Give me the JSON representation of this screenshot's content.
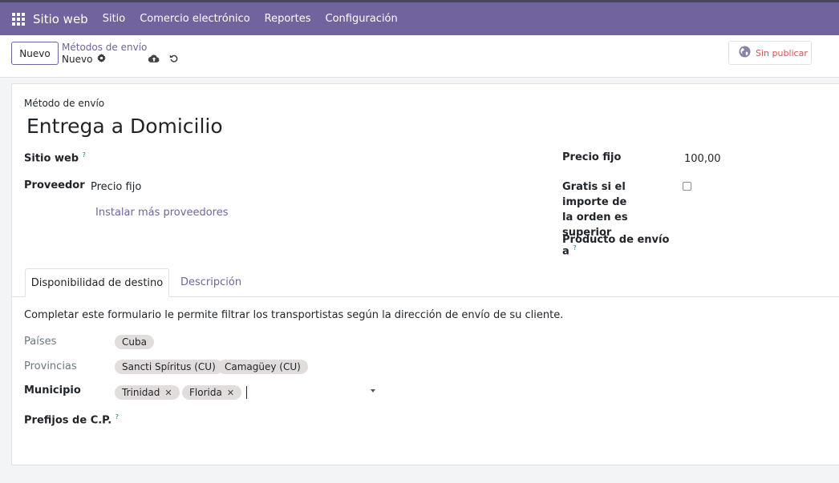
{
  "navbar": {
    "app_name": "Sitio web",
    "menu": [
      "Sitio",
      "Comercio electrónico",
      "Reportes",
      "Configuración"
    ]
  },
  "control_panel": {
    "new_button": "Nuevo",
    "breadcrumb_parent": "Métodos de envío",
    "breadcrumb_current": "Nuevo",
    "publish_button": "Sin publicar",
    "icons": [
      "apps-grid-icon",
      "gear-icon",
      "cloud-upload-icon",
      "undo-icon",
      "globe-icon"
    ]
  },
  "form": {
    "name_label": "Método de envío",
    "name_value": "Entrega a Domicilio",
    "website_label": "Sitio web",
    "help_mark": "?",
    "provider_label": "Proveedor",
    "provider_value": "Precio fijo",
    "install_link": "Instalar más proveedores",
    "fixed_price_label": "Precio fijo",
    "fixed_price_value": "100,00",
    "free_over_label_line1": "Gratis si el importe de",
    "free_over_label_line2": "la orden es superior",
    "free_over_label_line3": "a",
    "free_over_checked": false,
    "product_label": "Producto de envío"
  },
  "tabs": {
    "active": "Disponibilidad de destino",
    "other": "Descripción"
  },
  "destination": {
    "intro": "Completar este formulario le permite filtrar los transportistas según la dirección de envío de su cliente.",
    "countries_label": "Países",
    "countries": [
      "Cuba"
    ],
    "states_label": "Provincias",
    "states": [
      "Sancti Spíritus (CU)",
      "Camagüey (CU)"
    ],
    "municipality_label": "Municipio",
    "municipalities": [
      "Trinidad",
      "Florida"
    ],
    "remove_glyph": "✕",
    "zip_label": "Prefijos de C.P."
  },
  "colors": {
    "brand": "#71639e",
    "publish_text": "#d9534f",
    "tag_bg": "#e2dddd"
  }
}
